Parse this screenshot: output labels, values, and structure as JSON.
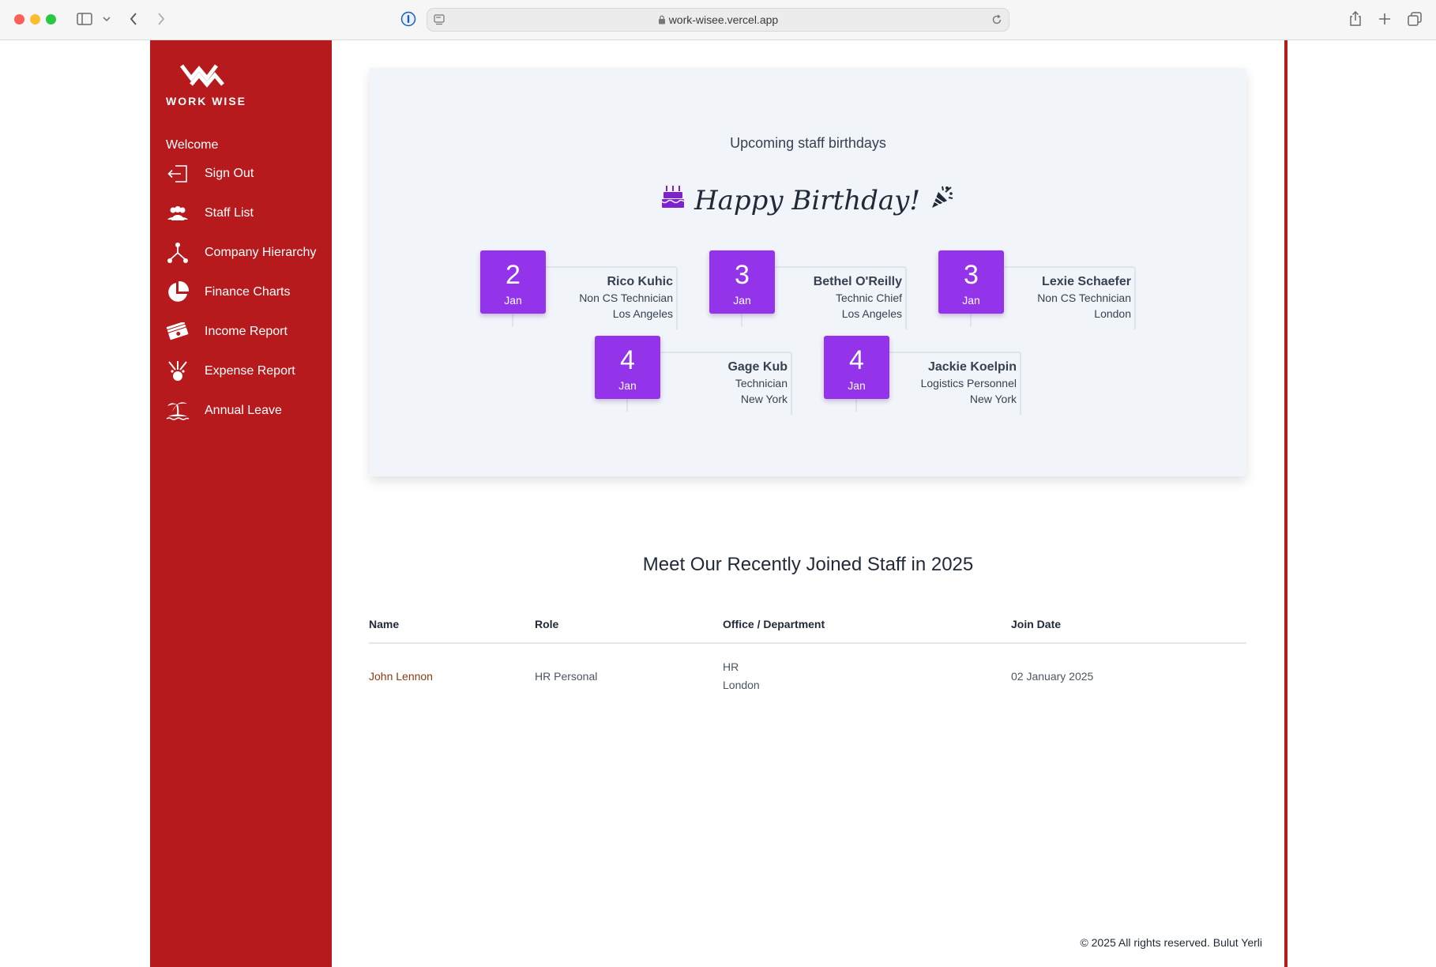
{
  "browser": {
    "url": "work-wisee.vercel.app"
  },
  "sidebar": {
    "logo_text": "WORK WISE",
    "welcome": "Welcome",
    "items": [
      {
        "label": "Sign Out",
        "icon": "sign-out-icon"
      },
      {
        "label": "Staff List",
        "icon": "users-icon"
      },
      {
        "label": "Company Hierarchy",
        "icon": "hierarchy-icon"
      },
      {
        "label": "Finance Charts",
        "icon": "pie-chart-icon"
      },
      {
        "label": "Income Report",
        "icon": "money-icon"
      },
      {
        "label": "Expense Report",
        "icon": "expense-icon"
      },
      {
        "label": "Annual Leave",
        "icon": "island-icon"
      }
    ]
  },
  "birthdays": {
    "heading": "Upcoming staff birthdays",
    "banner": "Happy Birthday!",
    "entries": [
      {
        "day": "2",
        "month": "Jan",
        "name": "Rico Kuhic",
        "role": "Non CS Technician",
        "city": "Los Angeles"
      },
      {
        "day": "3",
        "month": "Jan",
        "name": "Bethel O'Reilly",
        "role": "Technic Chief",
        "city": "Los Angeles"
      },
      {
        "day": "3",
        "month": "Jan",
        "name": "Lexie Schaefer",
        "role": "Non CS Technician",
        "city": "London"
      },
      {
        "day": "4",
        "month": "Jan",
        "name": "Gage Kub",
        "role": "Technician",
        "city": "New York"
      },
      {
        "day": "4",
        "month": "Jan",
        "name": "Jackie Koelpin",
        "role": "Logistics Personnel",
        "city": "New York"
      }
    ]
  },
  "recent": {
    "title": "Meet Our Recently Joined Staff in 2025",
    "columns": [
      "Name",
      "Role",
      "Office / Department",
      "Join Date"
    ],
    "rows": [
      {
        "name": "John Lennon",
        "role": "HR Personal",
        "department": "HR",
        "office": "London",
        "join_date": "02 January 2025"
      }
    ]
  },
  "footer": "© 2025 All rights reserved. Bulut Yerli",
  "colors": {
    "sidebar": "#b71a1c",
    "birthday_box": "#9333ea",
    "link": "#8a3c0f"
  }
}
